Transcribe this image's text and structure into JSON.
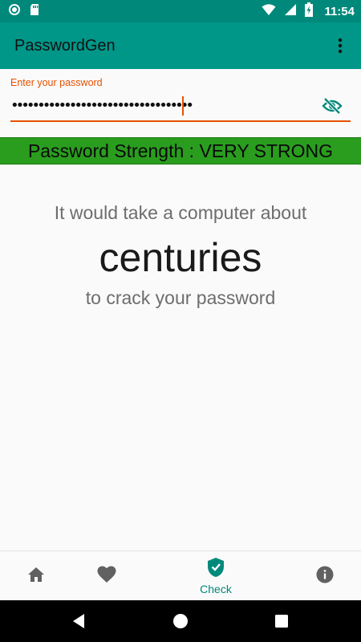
{
  "status_bar": {
    "time": "11:54",
    "icons": [
      "circle-notification-icon",
      "sd-card-icon",
      "wifi-icon",
      "signal-icon",
      "battery-charging-icon"
    ]
  },
  "app_bar": {
    "title": "PasswordGen",
    "menu_icon": "more-vert-icon"
  },
  "password_field": {
    "label": "Enter your password",
    "value": "••••••••••••••••••••••••••••••••••",
    "visibility_icon": "eye-off-icon"
  },
  "strength": {
    "text": "Password Strength : VERY STRONG",
    "color": "#2a9d1f"
  },
  "crack_message": {
    "prefix": "It would take a computer about",
    "duration": "centuries",
    "suffix": "to crack your password"
  },
  "bottom_nav": {
    "items": [
      {
        "icon": "home-icon",
        "label": ""
      },
      {
        "icon": "heart-icon",
        "label": ""
      },
      {
        "icon": "shield-check-icon",
        "label": "Check",
        "active": true
      },
      {
        "icon": "info-icon",
        "label": ""
      }
    ],
    "accent": "#00897b"
  },
  "system_nav": {
    "icons": [
      "back-icon",
      "home-circle-icon",
      "recents-icon"
    ]
  }
}
